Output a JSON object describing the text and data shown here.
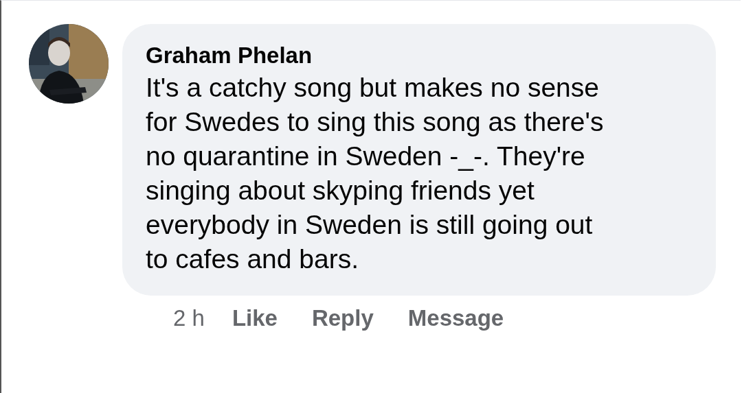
{
  "comment": {
    "author": "Graham Phelan",
    "text": "It's a catchy song but makes no sense for Swedes to sing this song as there's no quarantine in Sweden -_-. They're singing about skyping friends yet everybody in Sweden is still going out to cafes and bars.",
    "time": "2 h",
    "actions": [
      "Like",
      "Reply",
      "Message"
    ]
  }
}
